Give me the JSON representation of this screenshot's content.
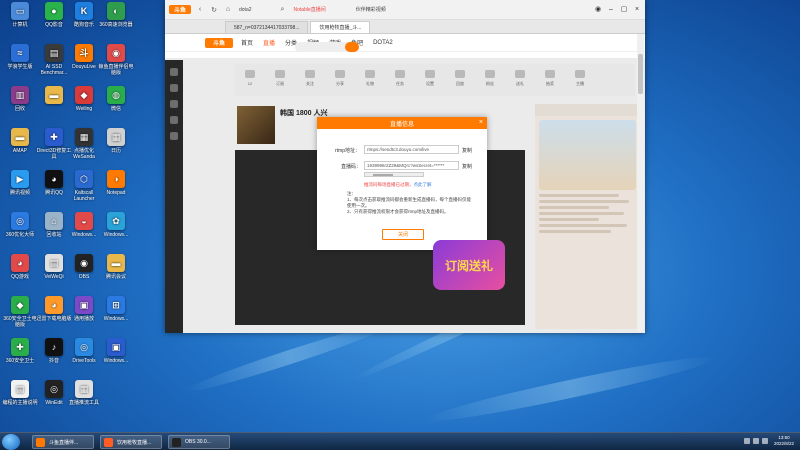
{
  "desktop_icons": [
    {
      "label": "计算机",
      "icon": "computer-icon",
      "color": "#4a8ad8",
      "glyph": "▭"
    },
    {
      "label": "QQ影音",
      "icon": "qq-video-icon",
      "color": "#2ab34a",
      "glyph": "●"
    },
    {
      "label": "酷狗音乐",
      "icon": "kugou-icon",
      "color": "#1d7fe0",
      "glyph": "K"
    },
    {
      "label": "360高速浏览器",
      "icon": "browser-360-icon",
      "color": "#2f9e4c",
      "glyph": "◐"
    },
    {
      "label": "学浪学生版",
      "icon": "xuelang-icon",
      "color": "#2b6fd6",
      "glyph": "≈"
    },
    {
      "label": "AI SSD Benchmar...",
      "icon": "ssd-benchmark-icon",
      "color": "#3a3a3a",
      "glyph": "▤"
    },
    {
      "label": "DouyuLive",
      "icon": "douyu-live-icon",
      "color": "#ff7a00",
      "glyph": "斗"
    },
    {
      "label": "鲸鱼直播伴侣电脑版",
      "icon": "whale-live-icon",
      "color": "#e24a4a",
      "glyph": "◉"
    },
    {
      "label": "回收",
      "icon": "winrar-icon",
      "color": "#8a3c8a",
      "glyph": "▥"
    },
    {
      "label": "",
      "icon": "folder-icon",
      "color": "#e8b84a",
      "glyph": "▬"
    },
    {
      "label": "Weiling",
      "icon": "weiling-icon",
      "color": "#d93a3a",
      "glyph": "◆"
    },
    {
      "label": "微信",
      "icon": "wechat-icon",
      "color": "#2aae4a",
      "glyph": "◍"
    },
    {
      "label": "AMAP",
      "icon": "amap-folder-icon",
      "color": "#e8b84a",
      "glyph": "▬"
    },
    {
      "label": "Direct3D修复工具",
      "icon": "d3d-repair-icon",
      "color": "#2a5cd0",
      "glyph": "✚"
    },
    {
      "label": "点播优化WeSanda",
      "icon": "wesanda-icon",
      "color": "#333333",
      "glyph": "▦"
    },
    {
      "label": "日历",
      "icon": "calendar-icon",
      "color": "#d0d0d0",
      "glyph": "▦"
    },
    {
      "label": "腾讯视频",
      "icon": "tencent-video-icon",
      "color": "#2a9cf0",
      "glyph": "▶"
    },
    {
      "label": "腾讯QQ",
      "icon": "qq-icon",
      "color": "#111111",
      "glyph": "◕"
    },
    {
      "label": "Kaltscall Launcher",
      "icon": "launcher-icon",
      "color": "#2a6ad0",
      "glyph": "⬡"
    },
    {
      "label": "Notepad",
      "icon": "notepad-icon",
      "color": "#ff7a00",
      "glyph": "◑"
    },
    {
      "label": "360优化大师",
      "icon": "optimizer-icon",
      "color": "#2a7ae2",
      "glyph": "◎"
    },
    {
      "label": "回收站",
      "icon": "recycle-bin-icon",
      "color": "#9ab3c8",
      "glyph": "⌂"
    },
    {
      "label": "Windows...",
      "icon": "windows-tool-icon",
      "color": "#e24a4a",
      "glyph": "◒"
    },
    {
      "label": "Windows...",
      "icon": "windows-settings-icon",
      "color": "#2aa3d8",
      "glyph": "✿"
    },
    {
      "label": "QQ游戏",
      "icon": "qq-game-icon",
      "color": "#e24a4a",
      "glyph": "◕"
    },
    {
      "label": "VeiWeQi",
      "icon": "veiweqi-icon",
      "color": "#e0e0e0",
      "glyph": "▤"
    },
    {
      "label": "OBS",
      "icon": "obs-icon",
      "color": "#222222",
      "glyph": "◉"
    },
    {
      "label": "腾讯会议",
      "icon": "tencent-meeting-icon",
      "color": "#e8b84a",
      "glyph": "▬"
    },
    {
      "label": "360安全卫士电脑版",
      "icon": "security-360-icon",
      "color": "#2aae4a",
      "glyph": "◆"
    },
    {
      "label": "迅雷下载电脑版",
      "icon": "thunder-icon",
      "color": "#ff9a2a",
      "glyph": "◕"
    },
    {
      "label": "通用播放",
      "icon": "player-icon",
      "color": "#7b4ac8",
      "glyph": "▣"
    },
    {
      "label": "Windows...",
      "icon": "windows-app-icon",
      "color": "#2a7ae2",
      "glyph": "⊞"
    },
    {
      "label": "360安全卫士",
      "icon": "guard-360-icon",
      "color": "#2aae4a",
      "glyph": "✚"
    },
    {
      "label": "抖音",
      "icon": "douyin-icon",
      "color": "#111111",
      "glyph": "♪"
    },
    {
      "label": "DriveTools",
      "icon": "drivetools-icon",
      "color": "#2a8ae2",
      "glyph": "◎"
    },
    {
      "label": "Windows...",
      "icon": "windows-media-icon",
      "color": "#2a5cd0",
      "glyph": "▣"
    },
    {
      "label": "编程的主播说明",
      "icon": "document-icon",
      "color": "#f2f2f2",
      "glyph": "▤"
    },
    {
      "label": "WinEdit",
      "icon": "winedit-icon",
      "color": "#222222",
      "glyph": "◎"
    },
    {
      "label": "直播推流工具",
      "icon": "stream-tool-icon",
      "color": "#e0e0e0",
      "glyph": "▦"
    }
  ],
  "browser": {
    "logo": "斗鱼",
    "address_text": "dota2",
    "tab_notice": "Notable直播间",
    "tab_notice2": "伙伴精彩视频",
    "tabs": [
      {
        "label": "587_n=0372134417033798..."
      },
      {
        "label": "饮用枪牧直播_斗..."
      }
    ]
  },
  "site": {
    "logo": "斗鱼",
    "nav": [
      "首页",
      "直播",
      "分类",
      "视频",
      "游戏",
      "鱼吧",
      "DOTA2"
    ],
    "active_nav": "直播",
    "toolbar": [
      "12",
      "订阅",
      "关注",
      "分享",
      "礼物",
      "任务",
      "设置",
      "回放",
      "粉丝",
      "送礼",
      "抽奖",
      "主播"
    ],
    "room_title": "韩国 1800 人兴"
  },
  "modal": {
    "title": "直播信息",
    "close": "×",
    "rtmp_label": "rtmp地址：",
    "rtmp_value": "rtmps://sendtc3.douyu.com/live",
    "rtmp_copy": "复制",
    "code_label": "直播码：",
    "code_value": "1939996r2Z29&MQrc?wsSecret=******",
    "code_copy": "复制",
    "warn": "推流码每场直播已过期，",
    "warn_link": "点此了解",
    "notes_title": "注：",
    "notes": [
      "1、每次点击获取推流码都会重新生成直播码，每个直播码仅能使用一次。",
      "2、只有获得推流权限才会获得rtmp地址及直播码。"
    ],
    "button": "关闭"
  },
  "player": {
    "gift_text": "订阅送礼"
  },
  "taskbar": {
    "items": [
      {
        "label": "斗鱼直播伴...",
        "color": "#ff7a00"
      },
      {
        "label": "饮用枪牧直播...",
        "color": "#ff5d23"
      },
      {
        "label": "OBS 30.0...",
        "color": "#222222"
      }
    ],
    "time": "13:50",
    "date": "2022/8/22"
  }
}
